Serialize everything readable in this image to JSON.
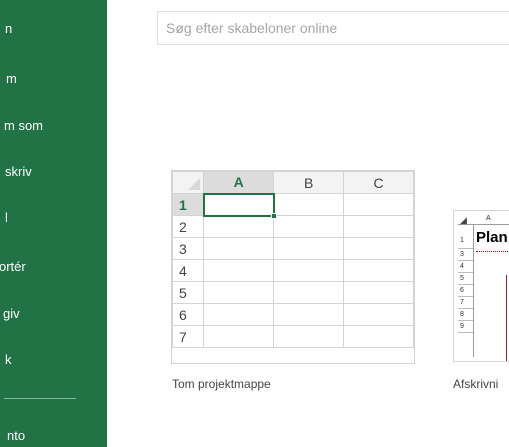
{
  "sidebar": {
    "items": [
      {
        "label": "n"
      },
      {
        "label": "m"
      },
      {
        "label": "m som"
      },
      {
        "label": "skriv"
      },
      {
        "label": "l"
      },
      {
        "label": "ortér"
      },
      {
        "label": "giv"
      },
      {
        "label": "k"
      },
      {
        "label": "nto"
      }
    ]
  },
  "search": {
    "placeholder": "Søg efter skabeloner online"
  },
  "blank_template": {
    "caption": "Tom projektmappe",
    "columns": [
      "A",
      "B",
      "C"
    ],
    "rows": [
      "1",
      "2",
      "3",
      "4",
      "5",
      "6",
      "7"
    ]
  },
  "second_template": {
    "caption": "Afskrivni",
    "column": "A",
    "title": "Plan",
    "rows": [
      "1",
      "3",
      "4",
      "5",
      "6",
      "7",
      "8",
      "9"
    ]
  },
  "colors": {
    "accent": "#217346"
  }
}
